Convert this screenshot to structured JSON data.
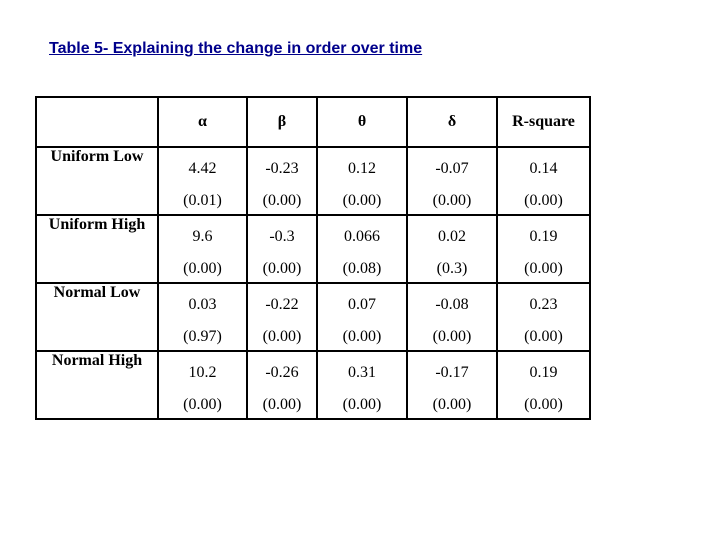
{
  "title": "Table 5- Explaining the change in order over time",
  "table": {
    "headers": [
      "",
      "α",
      "β",
      "θ",
      "δ",
      "R-square"
    ],
    "rows": [
      {
        "label": "Uniform Low",
        "cells": [
          {
            "coef": "4.42",
            "pval": "(0.01)"
          },
          {
            "coef": "-0.23",
            "pval": "(0.00)"
          },
          {
            "coef": "0.12",
            "pval": "(0.00)"
          },
          {
            "coef": "-0.07",
            "pval": "(0.00)"
          },
          {
            "coef": "0.14",
            "pval": "(0.00)"
          }
        ]
      },
      {
        "label": "Uniform High",
        "cells": [
          {
            "coef": "9.6",
            "pval": "(0.00)"
          },
          {
            "coef": "-0.3",
            "pval": "(0.00)"
          },
          {
            "coef": "0.066",
            "pval": "(0.08)"
          },
          {
            "coef": "0.02",
            "pval": "(0.3)"
          },
          {
            "coef": "0.19",
            "pval": "(0.00)"
          }
        ]
      },
      {
        "label": "Normal Low",
        "cells": [
          {
            "coef": "0.03",
            "pval": "(0.97)"
          },
          {
            "coef": "-0.22",
            "pval": "(0.00)"
          },
          {
            "coef": "0.07",
            "pval": "(0.00)"
          },
          {
            "coef": "-0.08",
            "pval": "(0.00)"
          },
          {
            "coef": "0.23",
            "pval": "(0.00)"
          }
        ]
      },
      {
        "label": "Normal High",
        "cells": [
          {
            "coef": "10.2",
            "pval": "(0.00)"
          },
          {
            "coef": "-0.26",
            "pval": "(0.00)"
          },
          {
            "coef": "0.31",
            "pval": "(0.00)"
          },
          {
            "coef": "-0.17",
            "pval": "(0.00)"
          },
          {
            "coef": "0.19",
            "pval": "(0.00)"
          }
        ]
      }
    ]
  },
  "colors": {
    "title": "#00008b",
    "text": "#000000",
    "border": "#000000"
  }
}
